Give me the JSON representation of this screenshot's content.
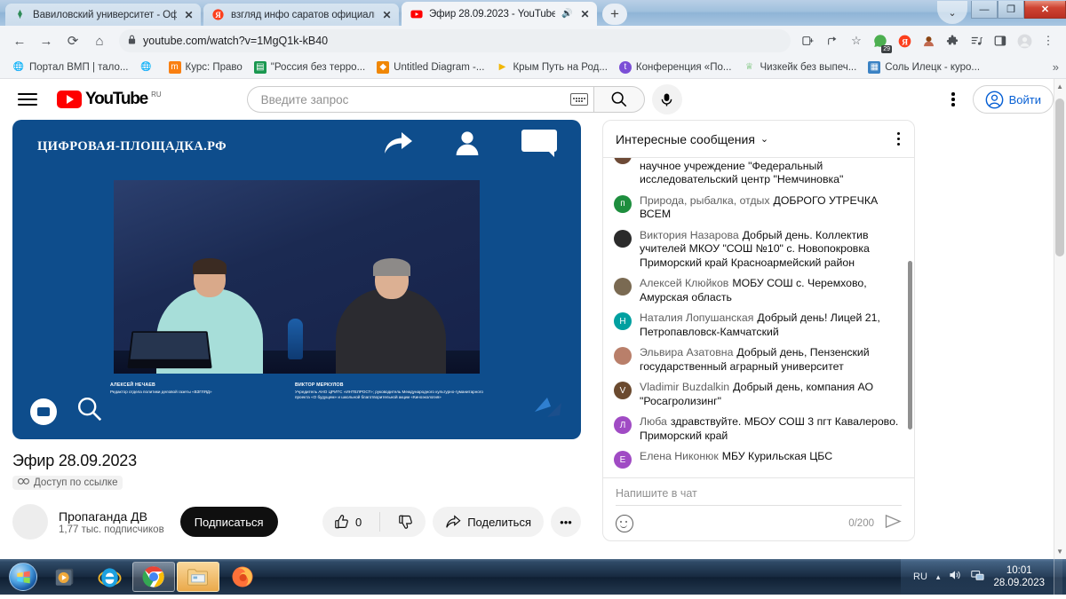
{
  "window": {
    "minimize_label": "—",
    "maximize_label": "❐",
    "close_label": "✕",
    "chevron_label": "⌄"
  },
  "browser": {
    "tabs": [
      {
        "title": "Вавиловский университет - Оф",
        "favicon": "vavilov-icon",
        "close": "✕",
        "active": false
      },
      {
        "title": "взгляд инфо саратов официаль",
        "favicon": "yandex-icon",
        "close": "✕",
        "active": false
      },
      {
        "title": "Эфир 28.09.2023 - YouTube",
        "favicon": "youtube-icon",
        "close": "✕",
        "active": true,
        "audio": "🔊"
      }
    ],
    "new_tab_label": "+",
    "nav": {
      "back": "←",
      "forward": "→",
      "reload": "⟳",
      "home": "⌂"
    },
    "omnibox": {
      "lock": "🔒",
      "url": "youtube.com/watch?v=1MgQ1k-kB40"
    },
    "toolbar_icons": [
      {
        "name": "install-app-icon",
        "glyph": "⬓"
      },
      {
        "name": "share-icon",
        "glyph": "⤻"
      },
      {
        "name": "bookmark-star-icon",
        "glyph": "☆"
      },
      {
        "name": "whatsapp-extension-icon",
        "glyph": "",
        "badge": "29"
      },
      {
        "name": "yandex-extension-icon",
        "glyph": "Я"
      },
      {
        "name": "avatar-extension-icon",
        "glyph": ""
      },
      {
        "name": "extensions-puzzle-icon",
        "glyph": "🧩"
      },
      {
        "name": "reading-list-icon",
        "glyph": "≡♪"
      },
      {
        "name": "side-panel-icon",
        "glyph": "▥"
      },
      {
        "name": "profile-icon",
        "glyph": "○"
      },
      {
        "name": "chrome-menu-icon",
        "glyph": "⋮"
      }
    ],
    "bookmarks": [
      {
        "label": "Портал ВМП | тало...",
        "icon": "globe-icon",
        "color": "#5f6368"
      },
      {
        "label": "",
        "icon": "globe-icon",
        "color": "#5f6368"
      },
      {
        "label": "Курс: Право",
        "icon": "moodle-icon",
        "color": "#f98012"
      },
      {
        "label": "\"Россия без терро...",
        "icon": "green-icon",
        "color": "#1a9850"
      },
      {
        "label": "Untitled Diagram -...",
        "icon": "drawio-icon",
        "color": "#f08705"
      },
      {
        "label": "Крым Путь на Род...",
        "icon": "play-icon",
        "color": "#f2b705"
      },
      {
        "label": "Конференция «По...",
        "icon": "timepad-icon",
        "color": "#7b4fd6"
      },
      {
        "label": "Чизкейк без выпеч...",
        "icon": "recipe-icon",
        "color": "#5cb85c"
      },
      {
        "label": "Соль Илецк - куро...",
        "icon": "photo-icon",
        "color": "#3b82c4"
      }
    ],
    "bookmarks_overflow": "»"
  },
  "youtube": {
    "menu_label": "menu",
    "logo_text": "YouTube",
    "logo_country": "RU",
    "search": {
      "placeholder": "Введите запрос",
      "keyboard_icon": "keyboard-icon",
      "search_icon": "search-icon"
    },
    "voice_search": "microphone-icon",
    "settings_dots": "⋮",
    "sign_in": "Войти"
  },
  "video": {
    "overlay_brand": "ЦИФРОВАЯ-ПЛОЩАДКА.РФ",
    "overlay_icons": [
      "share-arrow-icon",
      "person-icon",
      "speech-bubble-icon"
    ],
    "speakers": [
      {
        "name": "АЛЕКСЕЙ НЕЧАЕВ",
        "role": "Редактор отдела политики деловой газеты «ВЗГЛЯД»"
      },
      {
        "name": "ВИКТОР МЕРКУЛОВ",
        "role": "Учредитель АНО ЦРИТС «ИНТЕЛРОСТ»; руководитель Международного культурно-гуманитарного проекта «О будущем» и школьной благотворительной акции «Киноэкология»"
      }
    ],
    "title": "Эфир 28.09.2023",
    "visibility_badge": "Доступ по ссылке",
    "visibility_icon": "link-icon",
    "channel": {
      "name": "Пропаганда ДВ",
      "subscribers": "1,77 тыс. подписчиков",
      "subscribe_label": "Подписаться"
    },
    "actions": {
      "like_count": "0",
      "like_icon": "thumbs-up-icon",
      "dislike_icon": "thumbs-down-icon",
      "share_label": "Поделиться",
      "share_icon": "share-arrow-icon",
      "more_label": "•••"
    }
  },
  "chat": {
    "header_title": "Интересные сообщения",
    "header_chevron": "⌄",
    "header_menu": "⋮",
    "messages": [
      {
        "author": "",
        "text": "Федеральное государственное бюджетное научное учреждение \"Федеральный исследовательский центр \"Немчиновка\"",
        "avatar_letter": "",
        "avatar_color": "#6d4a36",
        "partial": true
      },
      {
        "author": "Природа, рыбалка, отдых",
        "text": "ДОБРОГО УТРЕЧКА ВСЕМ",
        "avatar_letter": "п",
        "avatar_color": "#1e8e3e"
      },
      {
        "author": "Виктория Назарова",
        "text": "Добрый день. Коллектив учителей МКОУ \"СОШ №10\" с. Новопокровка Приморский край Красноармейский район",
        "avatar_letter": "",
        "avatar_color": "#2b2b2b"
      },
      {
        "author": "Алексей Клюйков",
        "text": "МОБУ СОШ с. Черемхово, Амурская область",
        "avatar_letter": "",
        "avatar_color": "#7a6a52"
      },
      {
        "author": "Наталия Лопушанская",
        "text": "Добрый день! Лицей 21, Петропавловск-Камчатский",
        "avatar_letter": "Н",
        "avatar_color": "#00a0a0"
      },
      {
        "author": "Эльвира Азатовна",
        "text": "Добрый день, Пензенский государственный аграрный университет",
        "avatar_letter": "",
        "avatar_color": "#b97f6a"
      },
      {
        "author": "Vladimir Buzdalkin",
        "text": "Добрый день, компания АО \"Росагролизинг\"",
        "avatar_letter": "V",
        "avatar_color": "#6b4a2f"
      },
      {
        "author": "Люба",
        "text": "здравствуйте. МБОУ СОШ 3 пгт Кавалерово. Приморский край",
        "avatar_letter": "Л",
        "avatar_color": "#a04bc4"
      },
      {
        "author": "Елена Никонюк",
        "text": "МБУ Курильская ЦБС",
        "avatar_letter": "Е",
        "avatar_color": "#a04bc4"
      }
    ],
    "input_placeholder": "Напишите в чат",
    "emoji_icon": "emoji-icon",
    "char_count": "0/200",
    "send_icon": "send-icon"
  },
  "taskbar": {
    "start_label": "start-orb",
    "items": [
      {
        "name": "windows-media-player",
        "state": "normal"
      },
      {
        "name": "internet-explorer",
        "state": "normal"
      },
      {
        "name": "google-chrome",
        "state": "on"
      },
      {
        "name": "file-explorer",
        "state": "hot"
      },
      {
        "name": "mozilla-firefox",
        "state": "normal"
      }
    ],
    "tray": {
      "language": "RU",
      "show_hidden": "▴",
      "volume_icon": "volume-icon",
      "network_icon": "network-icon",
      "time": "10:01",
      "date": "28.09.2023"
    }
  }
}
